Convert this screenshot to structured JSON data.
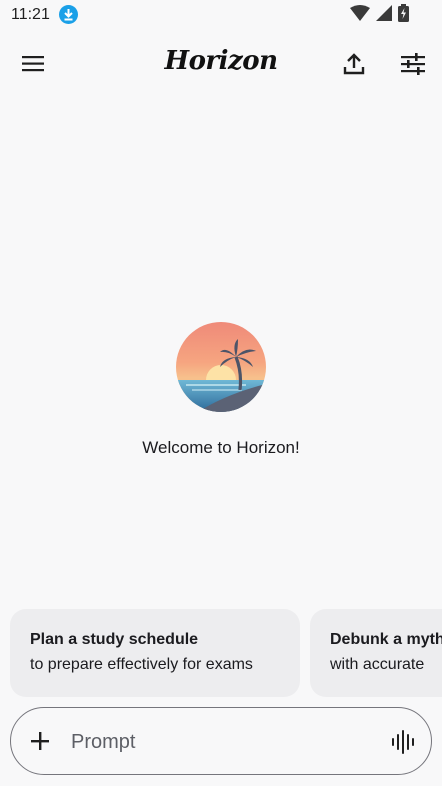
{
  "status_bar": {
    "time": "11:21"
  },
  "top_bar": {
    "title": "Horizon",
    "icons": [
      "menu-icon",
      "upload-icon",
      "tune-icon"
    ]
  },
  "main": {
    "welcome_text": "Welcome to Horizon!"
  },
  "suggestions": [
    {
      "title": "Plan a study schedule",
      "subtitle": "to prepare effectively for exams"
    },
    {
      "title": "Debunk a myth",
      "subtitle": "with accurate"
    }
  ],
  "prompt": {
    "placeholder": "Prompt",
    "value": ""
  },
  "colors": {
    "background": "#f8f8f9",
    "chip_background": "#ededef",
    "download_badge": "#1aa0e8"
  }
}
